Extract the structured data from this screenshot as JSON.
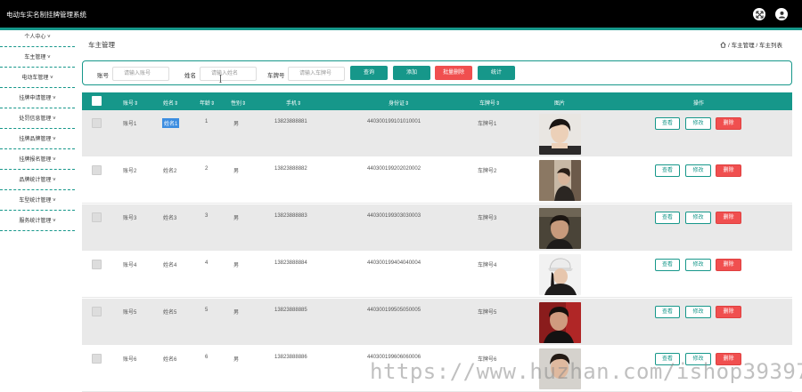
{
  "app": {
    "title": "电动车实名制挂牌管理系统"
  },
  "colors": {
    "accent": "#16978a",
    "danger": "#f04f4f",
    "topbar": "#000000"
  },
  "topbar_icons": [
    "fullscreen-icon",
    "user-icon"
  ],
  "sidebar": {
    "items": [
      {
        "label": "个人中心 ˅"
      },
      {
        "label": "车主管理 ˅"
      },
      {
        "label": "电动车管理 ˅"
      },
      {
        "label": "挂牌申请管理 ˅"
      },
      {
        "label": "处罚信息管理 ˅"
      },
      {
        "label": "挂牌品牌管理 ˅"
      },
      {
        "label": "挂牌报名管理 ˅"
      },
      {
        "label": "品牌统计管理 ˅"
      },
      {
        "label": "车型统计管理 ˅"
      },
      {
        "label": "服务统计管理 ˅"
      }
    ]
  },
  "page": {
    "title": "车主管理",
    "breadcrumb": "/ 车主管理 / 车主列表"
  },
  "search": {
    "account_label": "账号",
    "account_placeholder": "请输入账号",
    "name_label": "姓名",
    "name_placeholder": "请输入姓名",
    "plate_label": "车牌号",
    "plate_placeholder": "请输入车牌号",
    "query_btn": "查询",
    "add_btn": "添加",
    "batch_delete_btn": "批量删除",
    "stats_btn": "统计"
  },
  "table": {
    "headers": {
      "account": "账号⇕",
      "name": "姓名⇕",
      "age": "年龄⇕",
      "gender": "性别⇕",
      "phone": "手机⇕",
      "id_card": "身份证⇕",
      "plate": "车牌号⇕",
      "photo": "图片",
      "actions": "操作"
    },
    "view_label": "查看",
    "edit_label": "修改",
    "delete_label": "删除",
    "rows": [
      {
        "account": "账号1",
        "name": "姓名1",
        "age": "1",
        "gender": "男",
        "phone": "13823888881",
        "id_card": "440300199101010001",
        "plate": "车牌号1"
      },
      {
        "account": "账号2",
        "name": "姓名2",
        "age": "2",
        "gender": "男",
        "phone": "13823888882",
        "id_card": "440300199202020002",
        "plate": "车牌号2"
      },
      {
        "account": "账号3",
        "name": "姓名3",
        "age": "3",
        "gender": "男",
        "phone": "13823888883",
        "id_card": "440300199303030003",
        "plate": "车牌号3"
      },
      {
        "account": "账号4",
        "name": "姓名4",
        "age": "4",
        "gender": "男",
        "phone": "13823888884",
        "id_card": "440300199404040004",
        "plate": "车牌号4"
      },
      {
        "account": "账号5",
        "name": "姓名5",
        "age": "5",
        "gender": "男",
        "phone": "13823888885",
        "id_card": "440300199505050005",
        "plate": "车牌号5"
      },
      {
        "account": "账号6",
        "name": "姓名6",
        "age": "6",
        "gender": "男",
        "phone": "13823888886",
        "id_card": "440300199606060006",
        "plate": "车牌号6"
      }
    ]
  },
  "watermark": "https://www.huzhan.com/ishop39397"
}
